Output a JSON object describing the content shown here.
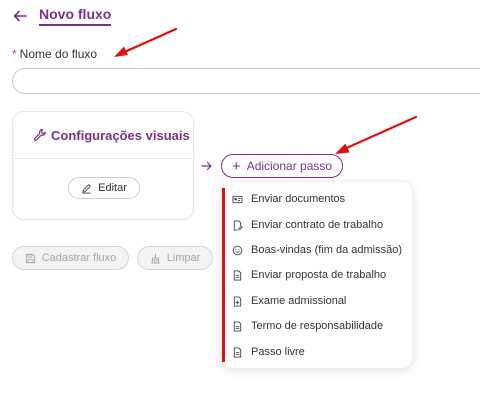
{
  "header": {
    "title": "Novo fluxo"
  },
  "form": {
    "required_mark": "*",
    "name_label": "Nome do fluxo",
    "name_value": ""
  },
  "card": {
    "title": "Configurações visuais",
    "edit_label": "Editar"
  },
  "add_step_label": "Adicionar passo",
  "menu": {
    "items": [
      {
        "label": "Enviar documentos",
        "icon": "id-card-icon"
      },
      {
        "label": "Enviar contrato de trabalho",
        "icon": "document-pen-icon"
      },
      {
        "label": "Boas-vindas (fim da admissão)",
        "icon": "smiley-icon"
      },
      {
        "label": "Enviar proposta de trabalho",
        "icon": "document-icon"
      },
      {
        "label": "Exame admissional",
        "icon": "medical-document-icon"
      },
      {
        "label": "Termo de responsabilidade",
        "icon": "document-icon"
      },
      {
        "label": "Passo livre",
        "icon": "document-icon"
      }
    ]
  },
  "actions": {
    "save_label": "Cadastrar fluxo",
    "clear_label": "Limpar"
  },
  "colors": {
    "accent": "#7a2f8f",
    "annotation": "#e01010",
    "required": "#d64545"
  }
}
